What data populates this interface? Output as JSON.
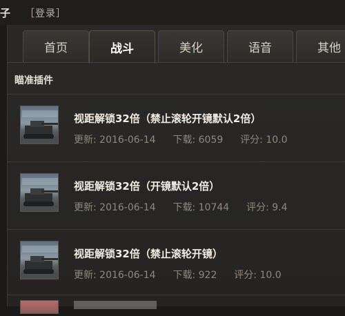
{
  "topbar": {
    "partial_text": "子",
    "login_label": "［登录］"
  },
  "tabs": [
    {
      "label": "首页",
      "active": false
    },
    {
      "label": "战斗",
      "active": true
    },
    {
      "label": "美化",
      "active": false
    },
    {
      "label": "语音",
      "active": false
    },
    {
      "label": "其他",
      "active": false
    }
  ],
  "section": {
    "title": "瞄准插件"
  },
  "items": [
    {
      "title": "视距解锁32倍（禁止滚轮开镜默认2倍）",
      "update_label": "更新:",
      "update_date": "2016-06-14",
      "download_label": "下载:",
      "downloads": "6059",
      "rating_label": "评分:",
      "rating": "10.0",
      "thumb_icon": "tank-icon"
    },
    {
      "title": "视距解锁32倍（开镜默认2倍）",
      "update_label": "更新:",
      "update_date": "2016-06-14",
      "download_label": "下载:",
      "downloads": "10744",
      "rating_label": "评分:",
      "rating": "9.4",
      "thumb_icon": "tank-icon"
    },
    {
      "title": "视距解锁32倍（禁止滚轮开镜）",
      "update_label": "更新:",
      "update_date": "2016-06-14",
      "download_label": "下载:",
      "downloads": "922",
      "rating_label": "评分:",
      "rating": "10.0",
      "thumb_icon": "tank-icon"
    }
  ],
  "colors": {
    "background": "#1b1a19",
    "panel": "#2a2927",
    "active_tab_text": "#ffffff",
    "meta_text": "#8e8880"
  }
}
